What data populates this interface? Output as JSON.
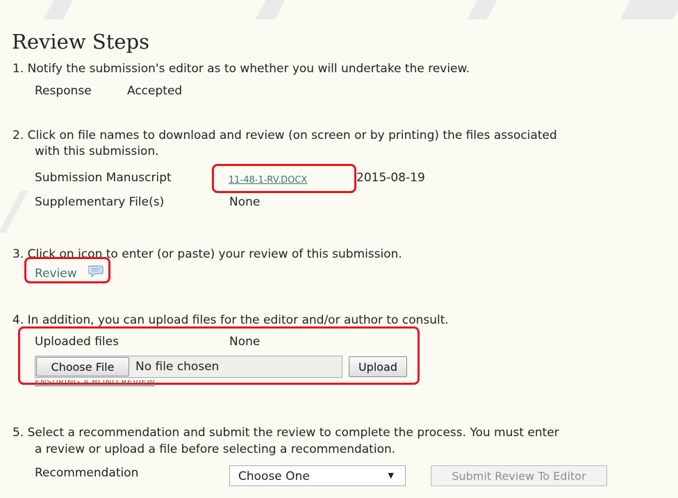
{
  "title": "Review Steps",
  "step1": {
    "text": "1. Notify the submission's editor as to whether you will undertake the review.",
    "response_label": "Response",
    "response_value": "Accepted"
  },
  "step2": {
    "text_line1": "2. Click on file names to download and review (on screen or by printing) the files associated",
    "text_line2": "with this submission.",
    "manuscript_label": "Submission Manuscript",
    "manuscript_file": "11-48-1-RV.DOCX",
    "manuscript_date": "2015-08-19",
    "supplementary_label": "Supplementary File(s)",
    "supplementary_value": "None"
  },
  "step3": {
    "text": "3. Click on icon to enter (or paste) your review of this submission.",
    "review_link": "Review",
    "icon": "speech-bubble-icon"
  },
  "step4": {
    "text": "4. In addition, you can upload files for the editor and/or author to consult.",
    "uploaded_label": "Uploaded files",
    "uploaded_value": "None",
    "choose_file_button": "Choose File",
    "no_file_text": "No file chosen",
    "upload_button": "Upload",
    "blind_review_link": "ENSURING A BLIND REVIEW"
  },
  "step5": {
    "text_line1": "5. Select a recommendation and submit the review to complete the process. You must enter",
    "text_line2": "a review or upload a file before selecting a recommendation.",
    "recommendation_label": "Recommendation",
    "recommendation_selected": "Choose One",
    "submit_button": "Submit Review To Editor"
  },
  "colors": {
    "background": "#fbfbf4",
    "link": "#37776e",
    "highlight": "#e8161e"
  }
}
